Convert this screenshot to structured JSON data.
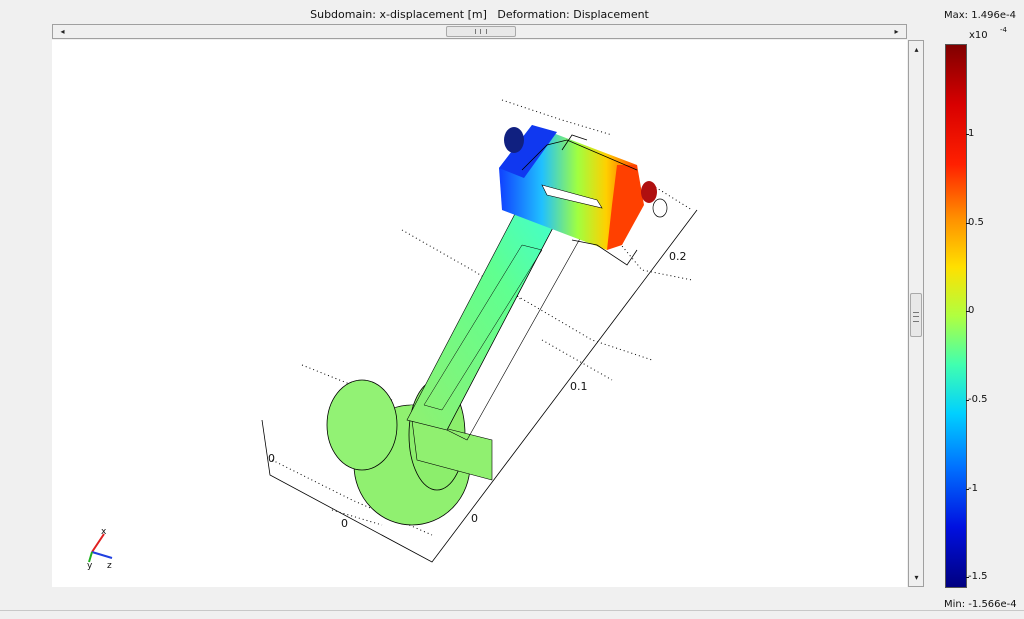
{
  "title": "Subdomain: x-displacement [m]   Deformation: Displacement",
  "colorbar": {
    "max_label": "Max: 1.496e-4",
    "min_label": "Min: -1.566e-4",
    "multiplier": "x10",
    "exponent": "-4",
    "ticks": [
      "1",
      "0.5",
      "0",
      "-0.5",
      "-1",
      "-1.5"
    ]
  },
  "axes": {
    "tick_02": "0.2",
    "tick_01": "0.1",
    "tick_0_right": "0",
    "tick_0_bottom": "0",
    "tick_0_left": "0"
  },
  "triad": {
    "x": "x",
    "y": "y",
    "z": "z"
  },
  "scroll": {
    "left_arrow": "◂",
    "right_arrow": "▸",
    "up_arrow": "▴",
    "down_arrow": "▾"
  },
  "colors": {
    "max_red": "#800000",
    "min_blue": "#000080",
    "zero_green": "#90f070"
  }
}
